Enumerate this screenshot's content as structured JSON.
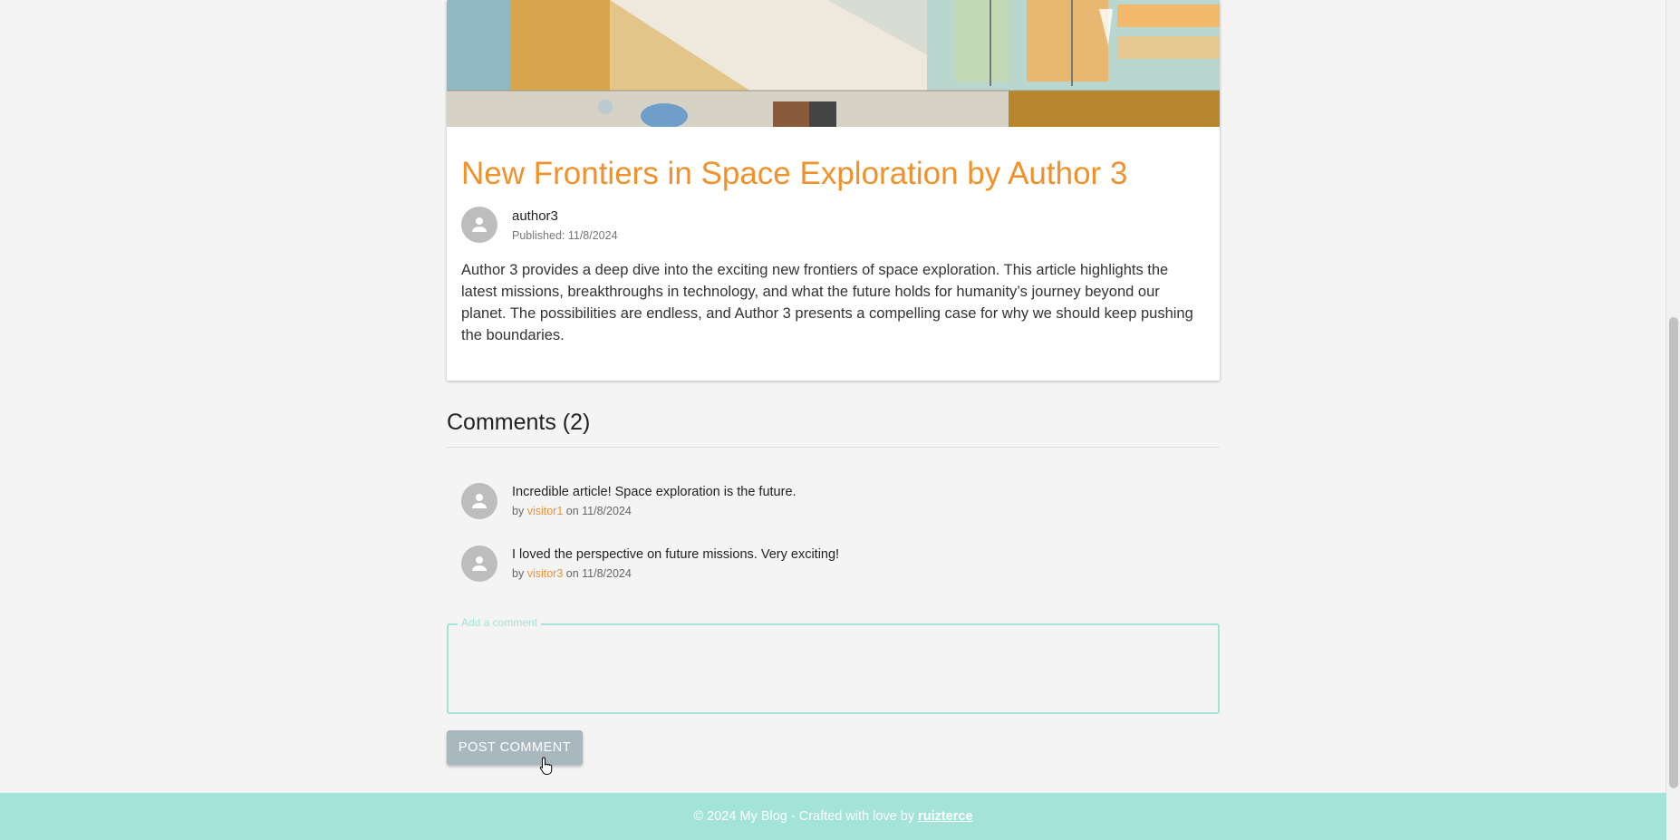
{
  "post": {
    "title": "New Frontiers in Space Exploration by Author 3",
    "author": "author3",
    "published": "Published: 11/8/2024",
    "content": "Author 3 provides a deep dive into the exciting new frontiers of space exploration. This article highlights the latest missions, breakthroughs in technology, and what the future holds for humanity’s journey beyond our planet. The possibilities are endless, and Author 3 presents a compelling case for why we should keep pushing the boundaries."
  },
  "comments_section": {
    "title": "Comments (2)",
    "items": [
      {
        "text": "Incredible article! Space exploration is the future.",
        "by": "by",
        "user": "visitor1",
        "on": "on",
        "date": "11/8/2024"
      },
      {
        "text": "I loved the perspective on future missions. Very exciting!",
        "by": "by",
        "user": "visitor3",
        "on": "on",
        "date": "11/8/2024"
      }
    ],
    "input_label": "Add a comment",
    "input_value": "",
    "post_button": "POST COMMENT"
  },
  "footer": {
    "text": "© 2024 My Blog - Crafted with love by",
    "link": "ruizterce"
  },
  "colors": {
    "accent": "#f0912c",
    "teal": "#a3e3d8",
    "button": "#a9b8bf"
  },
  "icons": {
    "avatar": "person-icon",
    "cursor": "hand-pointer-icon"
  }
}
